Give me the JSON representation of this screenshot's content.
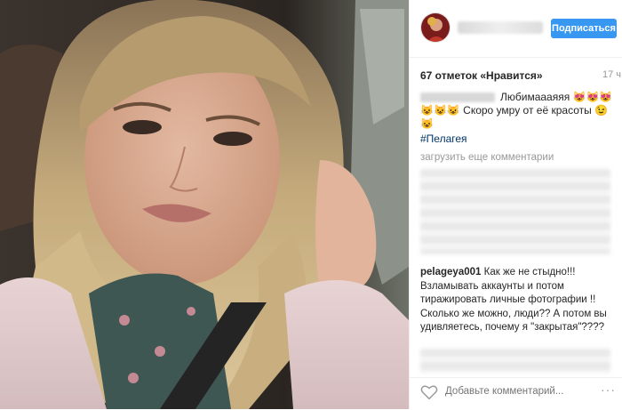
{
  "post": {
    "follow_label": "Подписаться",
    "likes_text": "67 отметок «Нравится»",
    "time_ago": "17 ч",
    "caption_line1": "Любимаааяяя 😻😻😻",
    "caption_line2": "😺😺😺 Скоро умру от её красоты 😉",
    "caption_line3": "😺",
    "hashtag": "#Пелагея",
    "load_more": "загрузить еще комментарии",
    "comment_user": "pelageya001",
    "comment_text": "Как же не стыдно!!! Взламывать аккаунты и потом тиражировать личные фотографии !! Сколько же можно, люди?? А потом вы удивляетесь, почему я \"закрытая\"????",
    "add_comment_placeholder": "Добавьте комментарий...",
    "more_icon": "···"
  },
  "icons": {
    "heart": "heart-icon",
    "more": "ellipsis-icon"
  },
  "colors": {
    "follow_button": "#3897f0",
    "hashtag": "#003569",
    "muted": "#999999"
  }
}
